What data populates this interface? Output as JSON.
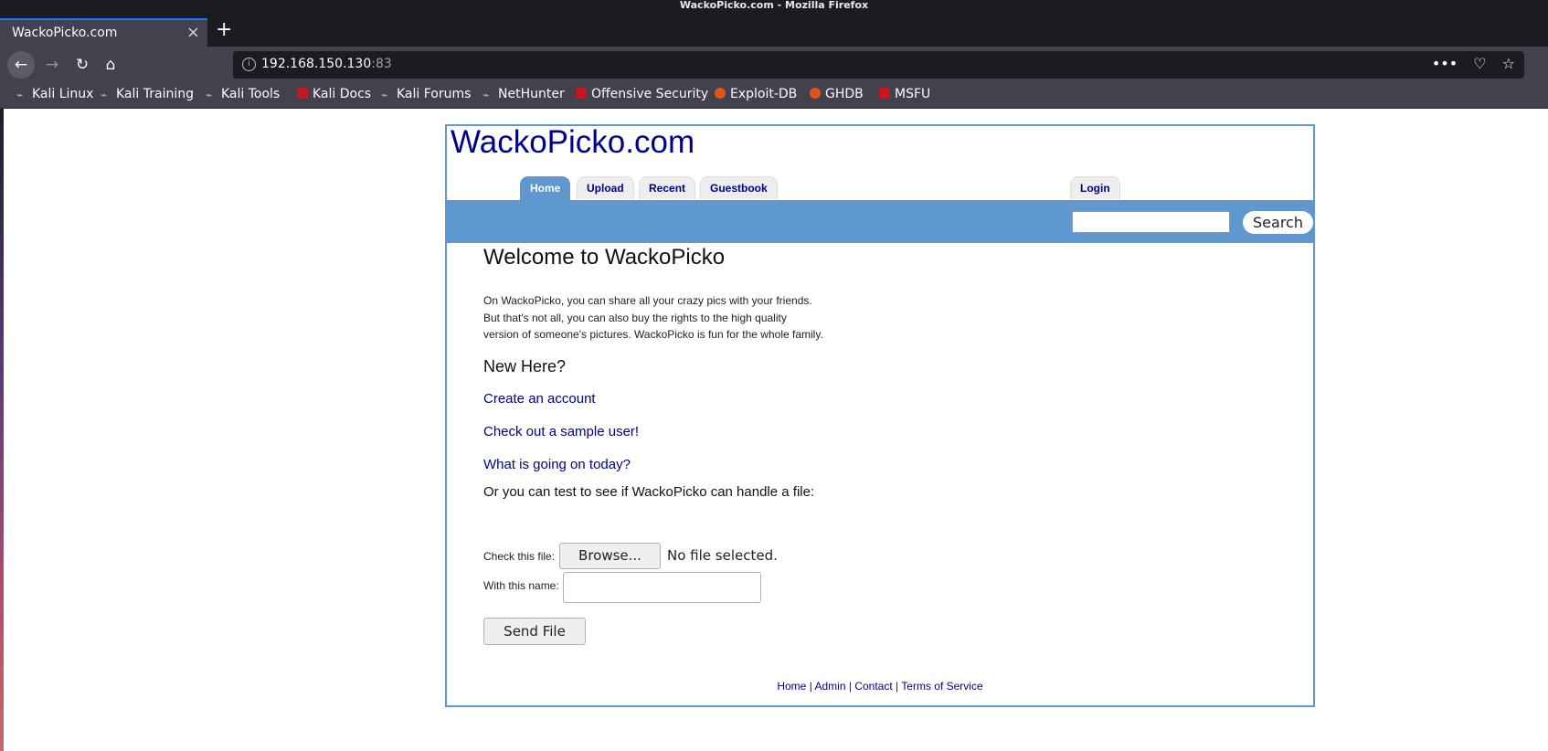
{
  "window": {
    "title": "WackoPicko.com - Mozilla Firefox"
  },
  "tab": {
    "title": "WackoPicko.com",
    "close": "×",
    "new_tab": "+"
  },
  "nav": {
    "back": "←",
    "forward": "→",
    "reload": "↻",
    "home": "⌂"
  },
  "urlbar": {
    "host": "192.168.150.130",
    "port": ":83",
    "info": "i",
    "more": "•••",
    "pocket": "♡",
    "star": "☆"
  },
  "bookmarks": [
    {
      "label": "Kali Linux",
      "icon": "kali-dragon-icon"
    },
    {
      "label": "Kali Training",
      "icon": "kali-dragon-icon"
    },
    {
      "label": "Kali Tools",
      "icon": "kali-dragon-icon"
    },
    {
      "label": "Kali Docs",
      "icon": "kali-docs-icon"
    },
    {
      "label": "Kali Forums",
      "icon": "kali-dragon-icon"
    },
    {
      "label": "NetHunter",
      "icon": "kali-dragon-icon"
    },
    {
      "label": "Offensive Security",
      "icon": "offsec-icon"
    },
    {
      "label": "Exploit-DB",
      "icon": "exploit-db-icon"
    },
    {
      "label": "GHDB",
      "icon": "exploit-db-icon"
    },
    {
      "label": "MSFU",
      "icon": "offsec-icon"
    }
  ],
  "site": {
    "title": "WackoPicko.com",
    "tabs": {
      "home": "Home",
      "upload": "Upload",
      "recent": "Recent",
      "guestbook": "Guestbook",
      "login": "Login"
    },
    "search_button": "Search",
    "welcome": "Welcome to WackoPicko",
    "intro": [
      "On WackoPicko, you can share all your crazy pics with your friends.",
      "But that's not all, you can also buy the rights to the high quality",
      "version of someone's pictures. WackoPicko is fun for the whole family."
    ],
    "new_here": "New Here?",
    "links": {
      "create": "Create an account",
      "sample": "Check out a sample user!",
      "today": "What is going on today?"
    },
    "file_test": "Or you can test to see if WackoPicko can handle a file:",
    "check_file_label": "Check this file:",
    "browse": "Browse...",
    "no_file": "No file selected.",
    "name_label": "With this name:",
    "name_value": "",
    "send": "Send File",
    "footer": {
      "home": "Home",
      "admin": "Admin",
      "contact": "Contact",
      "tos": "Terms of Service",
      "sep": "|"
    }
  },
  "colors": {
    "accent_blue": "#5f97cf",
    "link": "#00008b",
    "chrome_dark": "#1c1b22",
    "chrome": "#42414d"
  }
}
